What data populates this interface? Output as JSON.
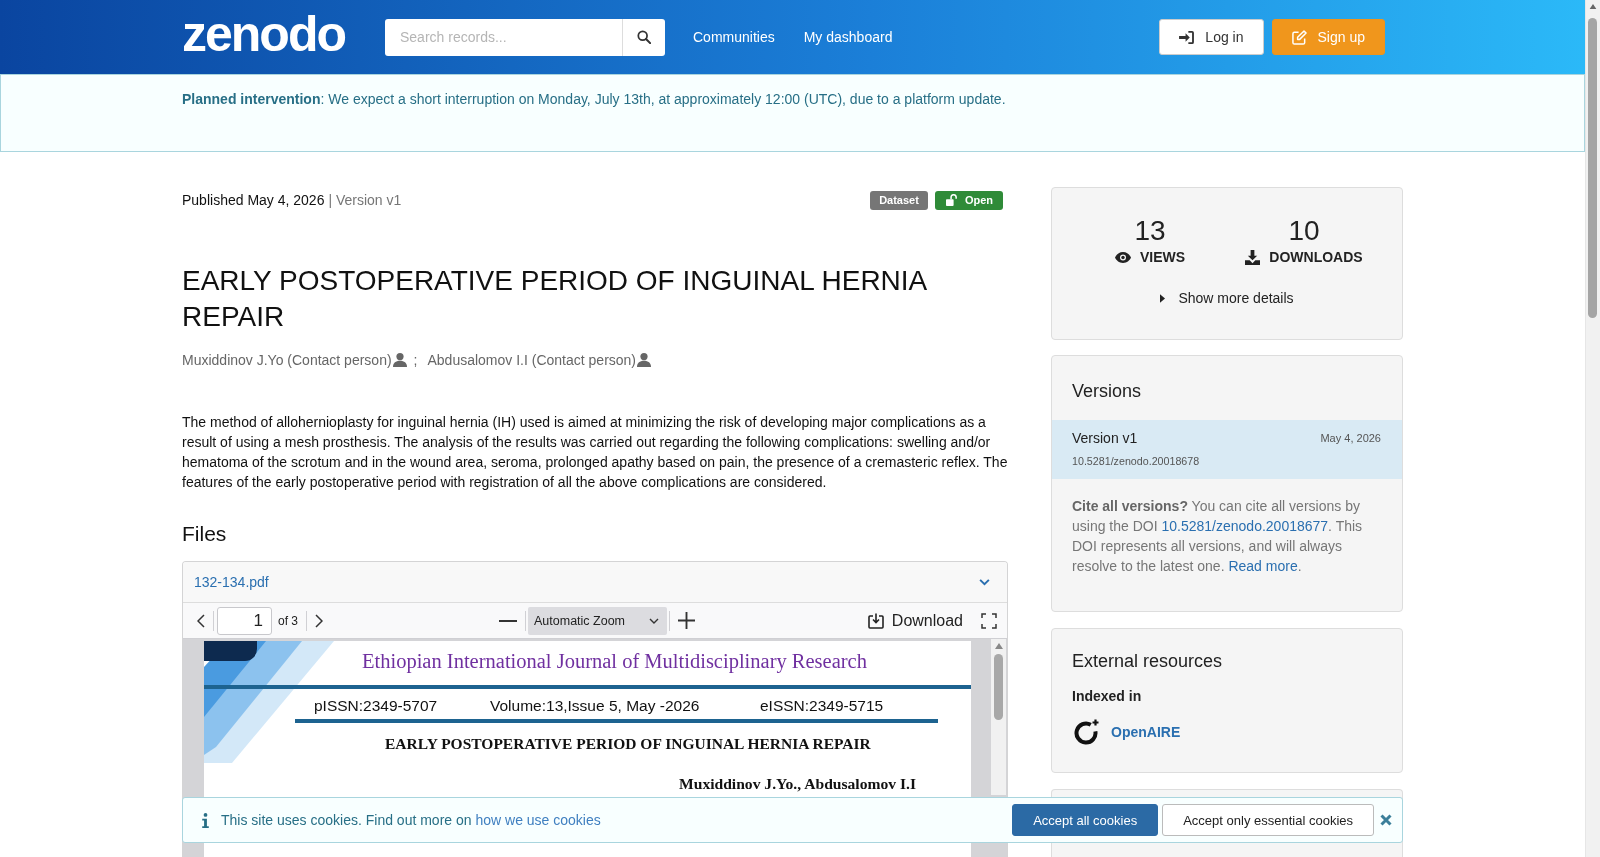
{
  "header": {
    "logo": "zenodo",
    "search": {
      "placeholder": "Search records..."
    },
    "nav": [
      {
        "label": "Communities"
      },
      {
        "label": "My dashboard"
      }
    ],
    "buttons": [
      {
        "label": "Log in",
        "kind": "login"
      },
      {
        "label": "Sign up",
        "kind": "signup"
      }
    ]
  },
  "banner": {
    "text": "**Planned intervention**: We expect a short interruption on Monday, July 13th, at approximately 12:00 (UTC), due to a platform update."
  },
  "record": {
    "published": "Published May 4, 2026",
    "version": "| Version v1",
    "badges": [
      {
        "label": "Dataset",
        "kind": "type"
      },
      {
        "label": "Open",
        "kind": "access"
      }
    ],
    "title": "EARLY POSTOPERATIVE PERIOD OF INGUINAL HERNIA REPAIR",
    "authors": [
      {
        "name": "Muxiddinov J.Yo (Contact person)"
      },
      {
        "name": "Abdusalomov I.I (Contact person)"
      }
    ],
    "author_separator": ";",
    "abstract": "The method of allohernioplasty for inguinal hernia (IH) used is aimed at minimizing the risk of developing major complications as a result of using a mesh prosthesis. The analysis of the results was carried out regarding the following complications: swelling and/or hematoma of the scrotum and in the wound area, seroma, prolonged apathy based on pain, the presence of a cremasteric reflex. The features of the early postoperative period with registration of all the above complications are considered."
  },
  "files": {
    "heading": "Files",
    "file_name": "132-134.pdf",
    "viewer": {
      "page": "1",
      "page_count": "of 3",
      "zoom": "Automatic Zoom",
      "download": "Download"
    },
    "preview": {
      "journal": "Ethiopian International Journal of Multidisciplinary Research",
      "issn_print": "pISSN:2349-5707",
      "volume": "Volume:13,Issue 5, May -2026",
      "issn_electronic": "eISSN:2349-5715",
      "title": "EARLY POSTOPERATIVE PERIOD OF INGUINAL HERNIA REPAIR",
      "authors": "Muxiddinov J.Yo., Abdusalomov I.I"
    }
  },
  "stats": {
    "items": [
      {
        "value": "13",
        "label": "VIEWS",
        "kind": "views"
      },
      {
        "value": "10",
        "label": "DOWNLOADS",
        "kind": "downloads"
      }
    ],
    "toggle": "Show more details"
  },
  "versions": {
    "heading": "Versions",
    "items": [
      {
        "label": "Version v1",
        "date": "May 4, 2026",
        "doi": "10.5281/zenodo.20018678",
        "selected": true
      }
    ],
    "cite": [
      {
        "kind": "text",
        "text": "**Cite all versions?** You can cite all versions by using the DOI "
      },
      {
        "kind": "link",
        "text": "10.5281/zenodo.20018677"
      },
      {
        "kind": "text",
        "text": ". This DOI represents all versions, and will always resolve to the latest one. "
      },
      {
        "kind": "link",
        "text": "Read more"
      },
      {
        "kind": "text",
        "text": "."
      }
    ]
  },
  "external": {
    "heading": "External resources",
    "subheading": "Indexed in",
    "resources": [
      {
        "name": "OpenAIRE"
      }
    ]
  },
  "cookies": {
    "message": [
      {
        "kind": "text",
        "text": "This site uses cookies. Find out more on "
      },
      {
        "kind": "link",
        "text": "how we use cookies"
      }
    ],
    "buttons": [
      {
        "label": "Accept all cookies",
        "kind": "primary"
      },
      {
        "label": "Accept only essential cookies",
        "kind": "secondary"
      }
    ]
  }
}
